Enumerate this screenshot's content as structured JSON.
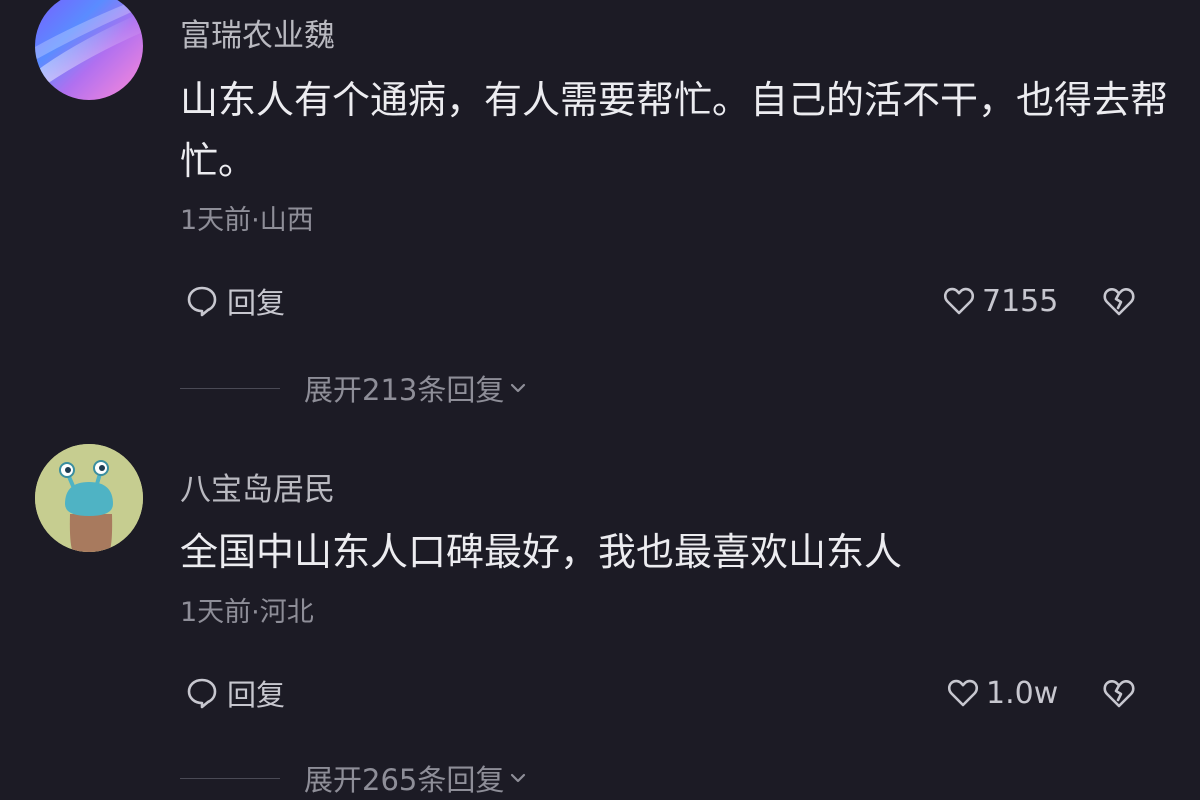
{
  "comments": [
    {
      "username": "富瑞农业魏",
      "content": "山东人有个通病，有人需要帮忙。自己的活不干，也得去帮忙。",
      "meta": "1天前·山西",
      "reply_label": "回复",
      "likes": "7155",
      "expand_label": "展开213条回复",
      "avatar": "gradient-avatar"
    },
    {
      "username": "八宝岛居民",
      "content": "全国中山东人口碑最好，我也最喜欢山东人",
      "meta": "1天前·河北",
      "reply_label": "回复",
      "likes": "1.0w",
      "expand_label": "展开265条回复",
      "avatar": "creature-avatar"
    }
  ],
  "colors": {
    "background": "#1c1b25",
    "text_primary": "#ececf0",
    "text_secondary": "#8e8e98"
  },
  "icons": {
    "reply": "comment-bubble-icon",
    "like": "heart-icon",
    "dislike": "broken-heart-icon",
    "expand": "chevron-down-icon"
  }
}
